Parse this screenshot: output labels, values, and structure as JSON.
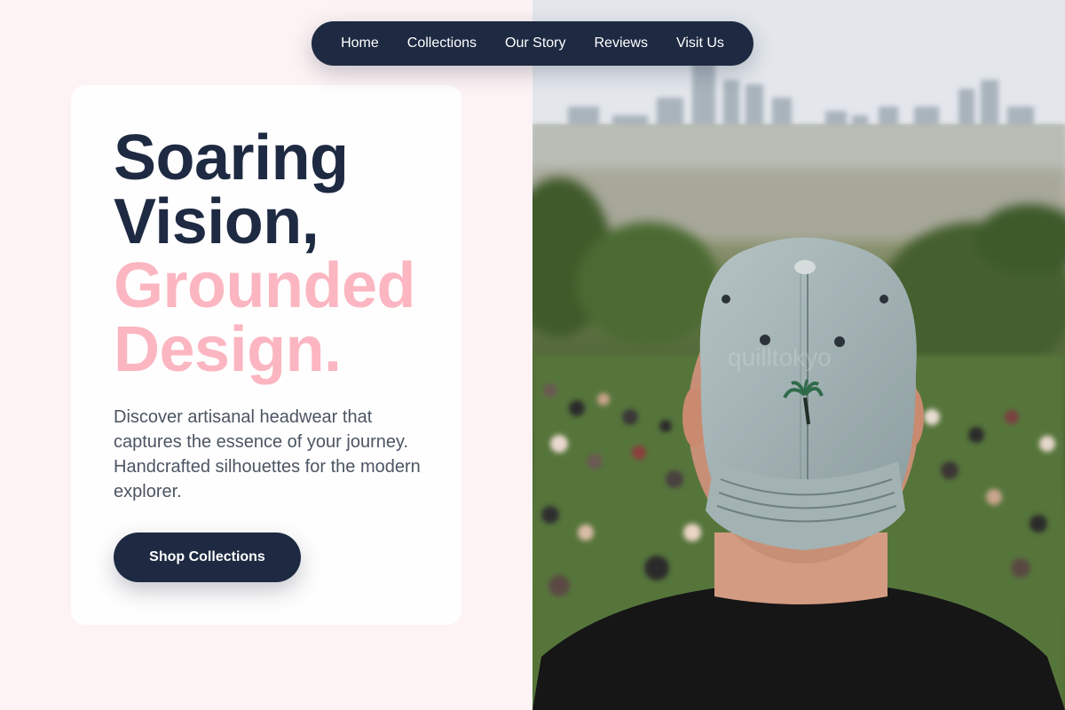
{
  "nav": {
    "items": [
      {
        "label": "Home"
      },
      {
        "label": "Collections"
      },
      {
        "label": "Our Story"
      },
      {
        "label": "Reviews"
      },
      {
        "label": "Visit Us"
      }
    ]
  },
  "hero": {
    "headline_dark_1": "Soaring",
    "headline_dark_2": "Vision,",
    "headline_pink_1": "Grounded",
    "headline_pink_2": "Design.",
    "description": "Discover artisanal headwear that captures the essence of your journey. Handcrafted silhouettes for the modern explorer.",
    "cta_label": "Shop Collections"
  },
  "colors": {
    "navy": "#1e2a42",
    "pink": "#fbb6c1",
    "background": "#fdf3f4",
    "text_muted": "#4b5563"
  },
  "photo": {
    "icon": "palm-tree-icon",
    "cap_watermark": "quilltokyo"
  }
}
